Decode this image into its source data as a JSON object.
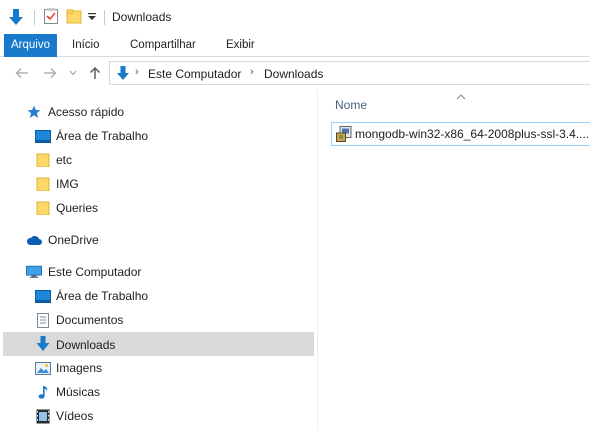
{
  "window": {
    "title": "Downloads"
  },
  "ribbon": {
    "tabs": [
      {
        "label": "Arquivo"
      },
      {
        "label": "Início"
      },
      {
        "label": "Compartilhar"
      },
      {
        "label": "Exibir"
      }
    ]
  },
  "address": {
    "crumbs": [
      "Este Computador",
      "Downloads"
    ]
  },
  "navpane": {
    "items": [
      {
        "label": "Acesso rápido",
        "icon": "star-icon"
      },
      {
        "label": "Área de Trabalho",
        "icon": "desktop-icon"
      },
      {
        "label": "etc",
        "icon": "folder-icon"
      },
      {
        "label": "IMG",
        "icon": "folder-icon"
      },
      {
        "label": "Queries",
        "icon": "folder-icon"
      },
      {
        "label": "OneDrive",
        "icon": "cloud-icon"
      },
      {
        "label": "Este Computador",
        "icon": "computer-icon"
      },
      {
        "label": "Área de Trabalho",
        "icon": "desktop-icon"
      },
      {
        "label": "Documentos",
        "icon": "document-icon"
      },
      {
        "label": "Downloads",
        "icon": "download-icon",
        "selected": true
      },
      {
        "label": "Imagens",
        "icon": "image-icon"
      },
      {
        "label": "Músicas",
        "icon": "music-icon"
      },
      {
        "label": "Vídeos",
        "icon": "video-icon"
      }
    ]
  },
  "content": {
    "column_header": "Nome",
    "files": [
      {
        "name": "mongodb-win32-x86_64-2008plus-ssl-3.4....",
        "icon": "installer-icon"
      }
    ]
  },
  "colors": {
    "accent": "#1979ca",
    "selection": "#d9d9d9",
    "file_highlight_border": "#99d1ff"
  }
}
